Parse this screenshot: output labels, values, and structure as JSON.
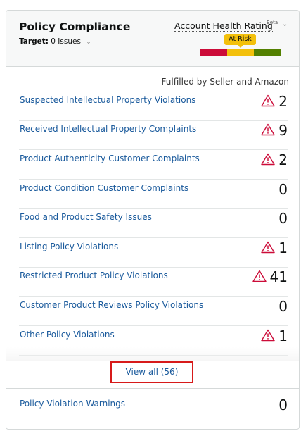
{
  "header": {
    "title": "Policy Compliance",
    "target_label": "Target:",
    "target_value": "0 Issues",
    "rating_label": "Account Health Rating",
    "rating_beta": "Beta",
    "status": "At Risk"
  },
  "subhead": "Fulfilled by Seller and Amazon",
  "rows": [
    {
      "label": "Suspected Intellectual Property Violations",
      "count": "2",
      "warning": true
    },
    {
      "label": "Received Intellectual Property Complaints",
      "count": "9",
      "warning": true
    },
    {
      "label": "Product Authenticity Customer Complaints",
      "count": "2",
      "warning": true
    },
    {
      "label": "Product Condition Customer Complaints",
      "count": "0",
      "warning": false
    },
    {
      "label": "Food and Product Safety Issues",
      "count": "0",
      "warning": false
    },
    {
      "label": "Listing Policy Violations",
      "count": "1",
      "warning": true
    },
    {
      "label": "Restricted Product Policy Violations",
      "count": "41",
      "warning": true
    },
    {
      "label": "Customer Product Reviews Policy Violations",
      "count": "0",
      "warning": false
    },
    {
      "label": "Other Policy Violations",
      "count": "1",
      "warning": true
    }
  ],
  "view_all": "View all (56)",
  "warnings_row": {
    "label": "Policy Violation Warnings",
    "count": "0"
  },
  "colors": {
    "link": "#1a5a9c",
    "warning": "#cc0c39",
    "at_risk": "#f3c00b",
    "good": "#538000",
    "highlight_border": "#d71a1a"
  }
}
